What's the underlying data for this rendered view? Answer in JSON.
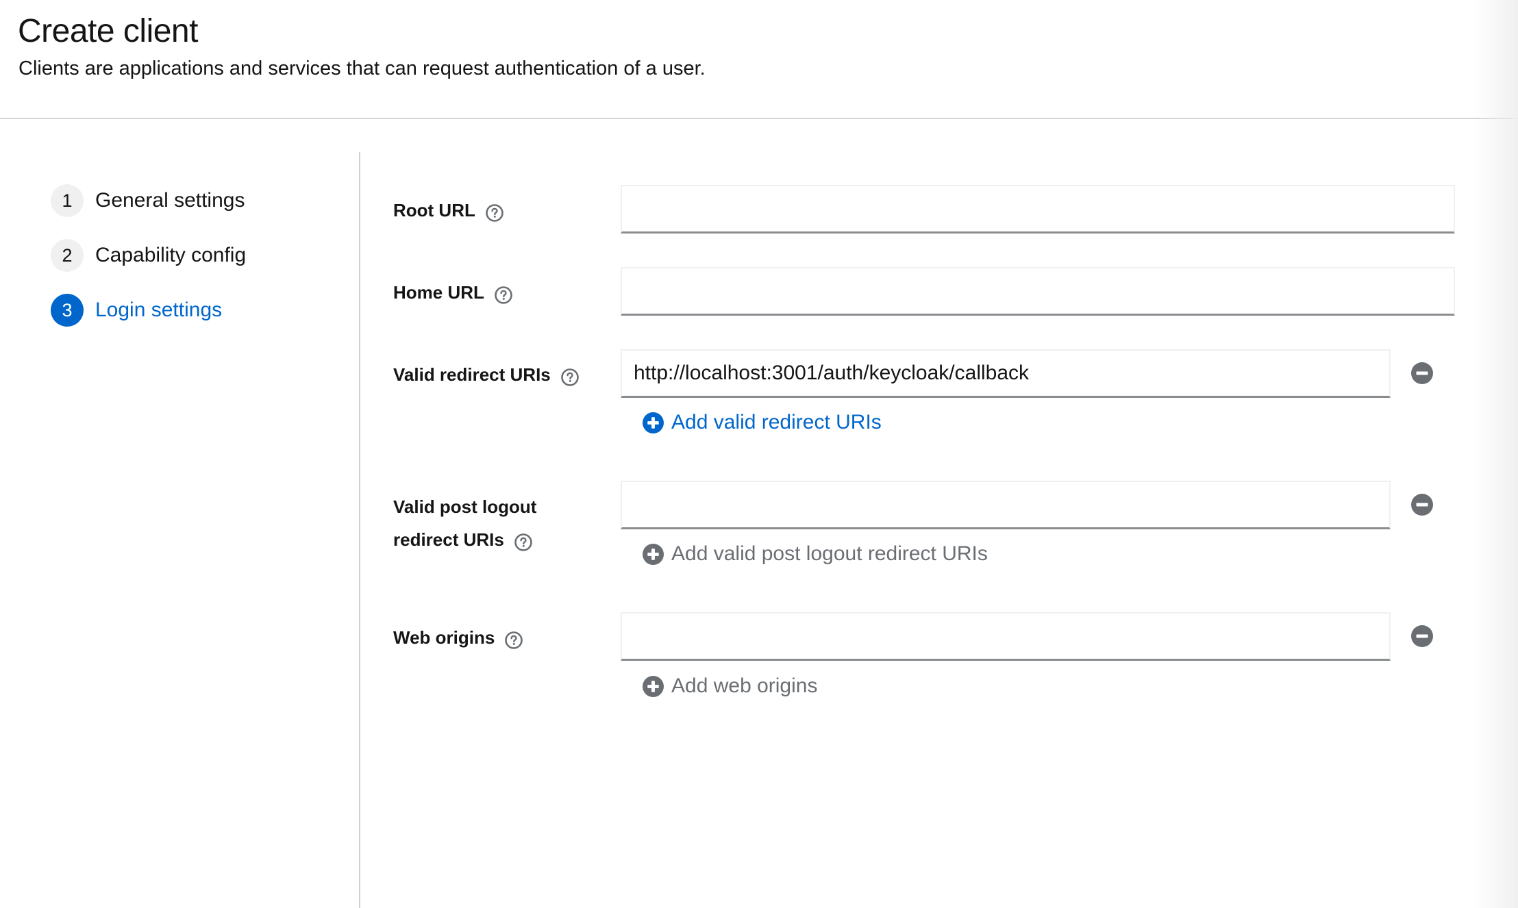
{
  "header": {
    "title": "Create client",
    "subtitle": "Clients are applications and services that can request authentication of a user."
  },
  "wizard": {
    "steps": [
      {
        "number": "1",
        "label": "General settings",
        "active": false
      },
      {
        "number": "2",
        "label": "Capability config",
        "active": false
      },
      {
        "number": "3",
        "label": "Login settings",
        "active": true
      }
    ]
  },
  "form": {
    "root_url": {
      "label": "Root URL",
      "value": "",
      "help_icon": "help-circle-icon"
    },
    "home_url": {
      "label": "Home URL",
      "value": "",
      "help_icon": "help-circle-icon"
    },
    "valid_redirect_uris": {
      "label": "Valid redirect URIs",
      "values": [
        "http://localhost:3001/auth/keycloak/callback"
      ],
      "add_label": "Add valid redirect URIs",
      "add_enabled": true,
      "help_icon": "help-circle-icon",
      "remove_icon": "minus-circle-icon",
      "add_icon": "plus-circle-icon"
    },
    "valid_post_logout_redirect_uris": {
      "label_line1": "Valid post logout",
      "label_line2": "redirect URIs",
      "values": [
        ""
      ],
      "add_label": "Add valid post logout redirect URIs",
      "add_enabled": false,
      "help_icon": "help-circle-icon",
      "remove_icon": "minus-circle-icon",
      "add_icon": "plus-circle-icon"
    },
    "web_origins": {
      "label": "Web origins",
      "values": [
        ""
      ],
      "add_label": "Add web origins",
      "add_enabled": false,
      "help_icon": "help-circle-icon",
      "remove_icon": "minus-circle-icon",
      "add_icon": "plus-circle-icon"
    }
  },
  "colors": {
    "accent": "#0066cc",
    "text": "#151515",
    "disabled": "#6a6e73",
    "divider": "#d2d2d2",
    "input_border_bottom": "#8a8d90"
  }
}
